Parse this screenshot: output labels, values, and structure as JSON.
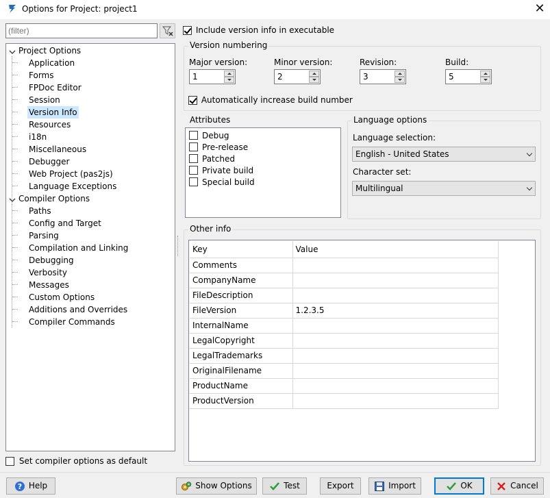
{
  "window": {
    "title": "Options for Project: project1",
    "close_glyph": "✕"
  },
  "filter": {
    "placeholder": "(filter)"
  },
  "tree": {
    "groups": [
      {
        "label": "Project Options",
        "items": [
          "Application",
          "Forms",
          "FPDoc Editor",
          "Session",
          "Version Info",
          "Resources",
          "i18n",
          "Miscellaneous",
          "Debugger",
          "Web Project (pas2js)",
          "Language Exceptions"
        ]
      },
      {
        "label": "Compiler Options",
        "items": [
          "Paths",
          "Config and Target",
          "Parsing",
          "Compilation and Linking",
          "Debugging",
          "Verbosity",
          "Messages",
          "Custom Options",
          "Additions and Overrides",
          "Compiler Commands"
        ]
      }
    ],
    "selected": "Version Info"
  },
  "set_default_label": "Set compiler options as default",
  "include_version_label": "Include version info in executable",
  "version_numbering": {
    "title": "Version numbering",
    "major_label": "Major version:",
    "major": "1",
    "minor_label": "Minor version:",
    "minor": "2",
    "revision_label": "Revision:",
    "revision": "3",
    "build_label": "Build:",
    "build": "5",
    "auto_increase_label": "Automatically increase build number"
  },
  "attributes": {
    "title": "Attributes",
    "items": [
      "Debug",
      "Pre-release",
      "Patched",
      "Private build",
      "Special build"
    ]
  },
  "language": {
    "title": "Language options",
    "selection_label": "Language selection:",
    "selection_value": "English - United States",
    "charset_label": "Character set:",
    "charset_value": "Multilingual"
  },
  "other_info": {
    "title": "Other info",
    "columns": [
      "Key",
      "Value"
    ],
    "rows": [
      [
        "Comments",
        ""
      ],
      [
        "CompanyName",
        ""
      ],
      [
        "FileDescription",
        ""
      ],
      [
        "FileVersion",
        "1.2.3.5"
      ],
      [
        "InternalName",
        ""
      ],
      [
        "LegalCopyright",
        ""
      ],
      [
        "LegalTrademarks",
        ""
      ],
      [
        "OriginalFilename",
        ""
      ],
      [
        "ProductName",
        ""
      ],
      [
        "ProductVersion",
        ""
      ]
    ]
  },
  "buttons": {
    "help": "Help",
    "show_options": "Show Options",
    "test": "Test",
    "export": "Export",
    "import": "Import",
    "ok": "OK",
    "cancel": "Cancel"
  },
  "colors": {
    "selection": "#cce8ff",
    "accent": "#0078d7"
  }
}
